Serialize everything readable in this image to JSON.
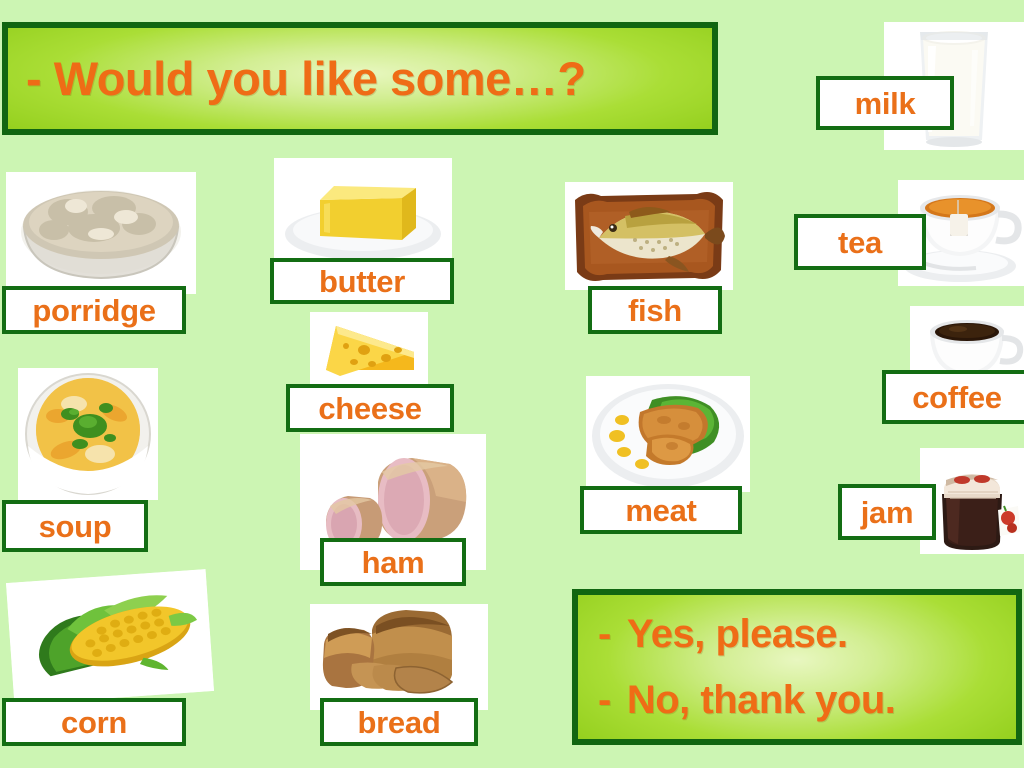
{
  "slide": {
    "background_color": "#ccf5b3",
    "accent_orange": "#ea7019",
    "border_green": "#136d13",
    "banner_green": "#8fcc18"
  },
  "title": {
    "text": "- Would you like some…?"
  },
  "answers": {
    "yes": {
      "dash": "-",
      "text": "Yes, please."
    },
    "no": {
      "dash": "-",
      "text": "No, thank you."
    }
  },
  "vocabulary": [
    {
      "word": "porridge",
      "picture": "bowl-of-porridge"
    },
    {
      "word": "soup",
      "picture": "bowl-of-soup"
    },
    {
      "word": "corn",
      "picture": "corn-cob"
    },
    {
      "word": "butter",
      "picture": "butter-on-plate"
    },
    {
      "word": "cheese",
      "picture": "cheese-wedge"
    },
    {
      "word": "ham",
      "picture": "ham-joints"
    },
    {
      "word": "bread",
      "picture": "bread-loaves"
    },
    {
      "word": "fish",
      "picture": "fish-on-board"
    },
    {
      "word": "meat",
      "picture": "meat-on-plate"
    },
    {
      "word": "milk",
      "picture": "glass-of-milk"
    },
    {
      "word": "tea",
      "picture": "cup-of-tea"
    },
    {
      "word": "coffee",
      "picture": "cup-of-coffee"
    },
    {
      "word": "jam",
      "picture": "jar-of-jam"
    }
  ]
}
